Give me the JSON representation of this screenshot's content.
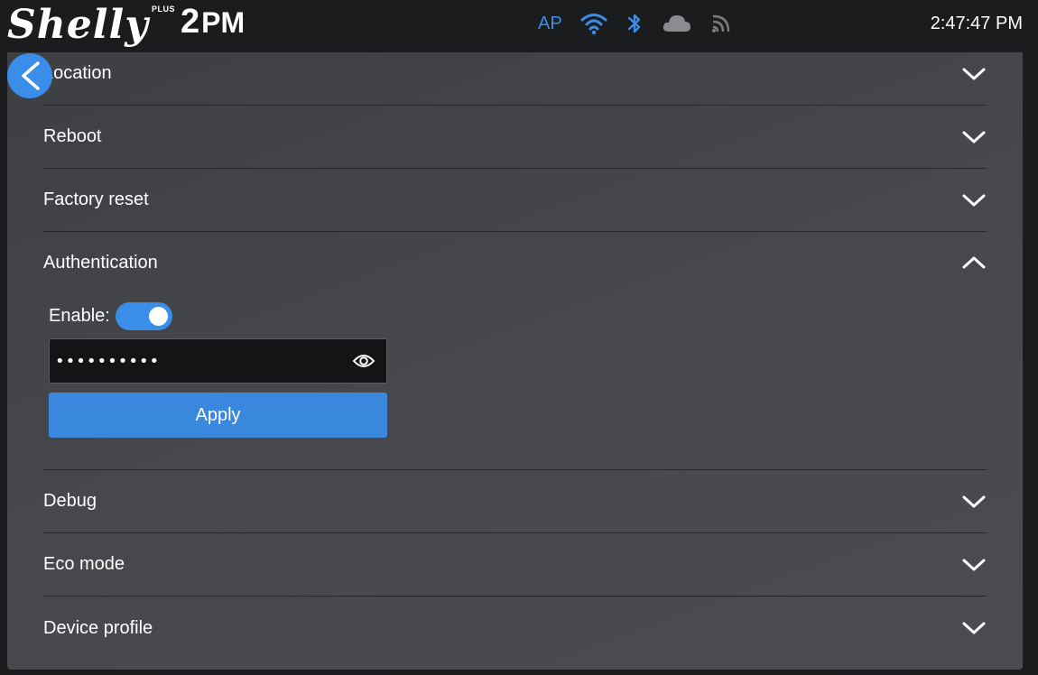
{
  "header": {
    "brand": "Shelly",
    "plus": "PLUS",
    "model_num": "2",
    "model_suffix": "PM",
    "ap_label": "AP",
    "clock": "2:47:47 PM",
    "icons": [
      "wifi-icon",
      "bluetooth-icon",
      "cloud-icon",
      "mqtt-icon"
    ],
    "accent_color": "#3a8eea"
  },
  "sections": [
    {
      "label": "Location",
      "expanded": false
    },
    {
      "label": "Reboot",
      "expanded": false
    },
    {
      "label": "Factory reset",
      "expanded": false
    },
    {
      "label": "Authentication",
      "expanded": true
    },
    {
      "label": "Debug",
      "expanded": false
    },
    {
      "label": "Eco mode",
      "expanded": false
    },
    {
      "label": "Device profile",
      "expanded": false
    }
  ],
  "authentication": {
    "enable_label": "Enable:",
    "enabled": true,
    "password_value": "••••••••••",
    "apply_label": "Apply"
  }
}
